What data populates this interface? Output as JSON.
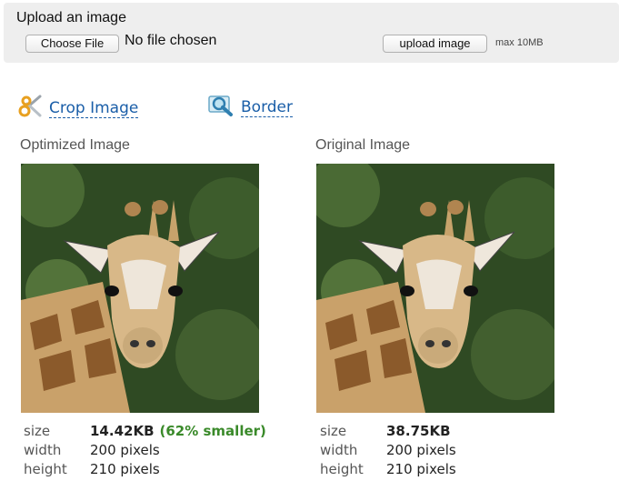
{
  "upload": {
    "title": "Upload an image",
    "choose_file_label": "Choose File",
    "no_file_text": "No file chosen",
    "upload_button_label": "upload image",
    "max_size": "max 10MB"
  },
  "tools": {
    "crop_label": "Crop Image",
    "crop_icon": "scissors-icon",
    "border_label": "Border",
    "border_icon": "magnifier-icon"
  },
  "optimized": {
    "title": "Optimized Image",
    "size_label": "size",
    "size_value": "14.42KB",
    "savings": "(62% smaller)",
    "width_label": "width",
    "width_value": "200 pixels",
    "height_label": "height",
    "height_value": "210 pixels"
  },
  "original": {
    "title": "Original Image",
    "size_label": "size",
    "size_value": "38.75KB",
    "width_label": "width",
    "width_value": "200 pixels",
    "height_label": "height",
    "height_value": "210 pixels"
  },
  "colors": {
    "link": "#1a5ea8",
    "savings_green": "#3a8a2a",
    "panel_bg": "#eeeeee"
  }
}
